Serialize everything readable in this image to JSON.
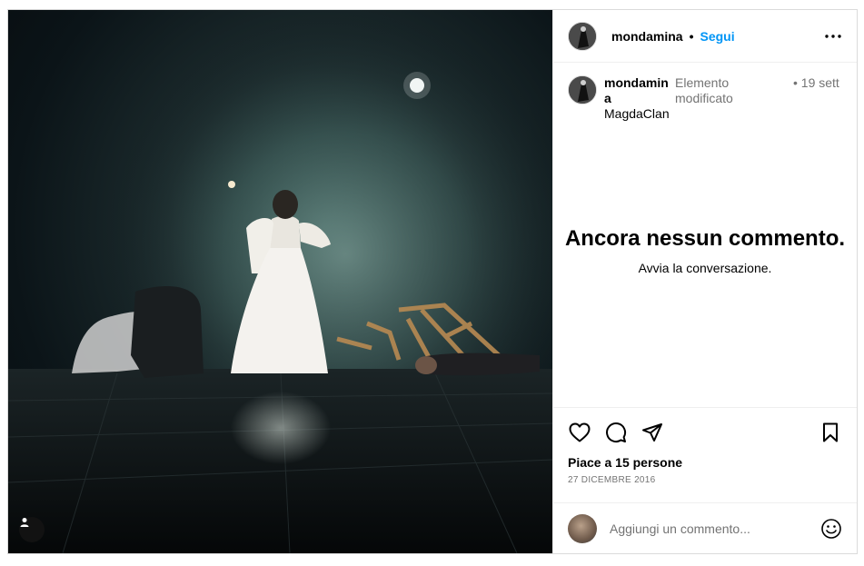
{
  "post": {
    "author": "mondamina",
    "follow_label": "Segui",
    "separator": "•",
    "more_icon": "more-horizontal-icon"
  },
  "caption": {
    "user_part1": "mondamina",
    "user_part2": "MagdaClan",
    "text": "Elemento modificato",
    "date": "• 19 sett"
  },
  "comments_empty": {
    "title": "Ancora nessun commento.",
    "subtitle": "Avvia la conversazione."
  },
  "actions": {
    "like_icon": "heart-icon",
    "comment_icon": "comment-icon",
    "share_icon": "send-icon",
    "save_icon": "bookmark-icon",
    "likes_text": "Piace a 15 persone",
    "date_text": "27 DICEMBRE 2016"
  },
  "comment_box": {
    "placeholder": "Aggiungi un commento...",
    "emoji_icon": "emoji-icon"
  },
  "colors": {
    "accent": "#0095f6",
    "secondary_text": "#737373",
    "border": "#dbdbdb"
  }
}
